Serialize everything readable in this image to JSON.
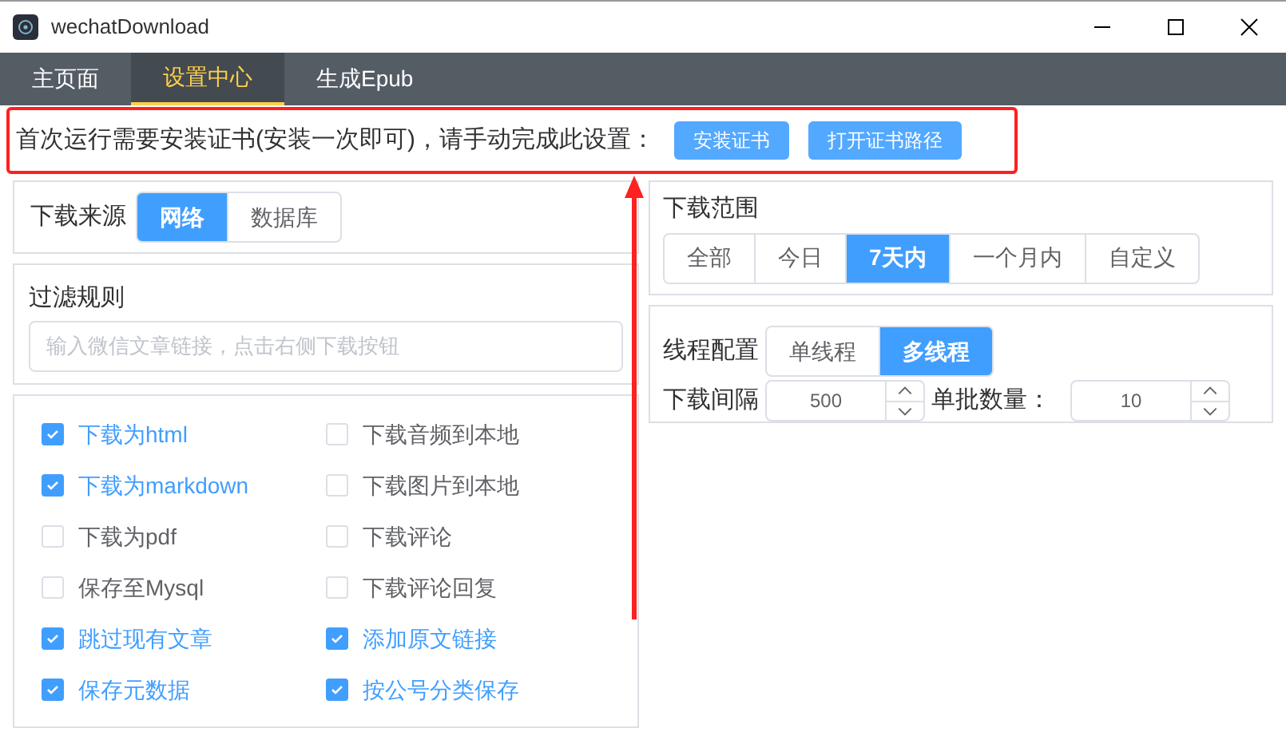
{
  "window": {
    "title": "wechatDownload"
  },
  "tabs": [
    {
      "label": "主页面",
      "selected": false
    },
    {
      "label": "设置中心",
      "selected": true
    },
    {
      "label": "生成Epub",
      "selected": false
    }
  ],
  "notice": {
    "text": "首次运行需要安装证书(安装一次即可)，请手动完成此设置：",
    "buttons": [
      "安装证书",
      "打开证书路径"
    ]
  },
  "source": {
    "label": "下载来源",
    "options": [
      {
        "label": "网络",
        "selected": true
      },
      {
        "label": "数据库",
        "selected": false
      }
    ]
  },
  "filter": {
    "label": "过滤规则",
    "placeholder": "输入微信文章链接，点击右侧下载按钮"
  },
  "options": [
    {
      "label": "下载为html",
      "checked": true
    },
    {
      "label": "下载音频到本地",
      "checked": false
    },
    {
      "label": "下载为markdown",
      "checked": true
    },
    {
      "label": "下载图片到本地",
      "checked": false
    },
    {
      "label": "下载为pdf",
      "checked": false
    },
    {
      "label": "下载评论",
      "checked": false
    },
    {
      "label": "保存至Mysql",
      "checked": false
    },
    {
      "label": "下载评论回复",
      "checked": false
    },
    {
      "label": "跳过现有文章",
      "checked": true
    },
    {
      "label": "添加原文链接",
      "checked": true
    },
    {
      "label": "保存元数据",
      "checked": true
    },
    {
      "label": "按公号分类保存",
      "checked": true
    }
  ],
  "range": {
    "label": "下载范围",
    "options": [
      {
        "label": "全部",
        "selected": false
      },
      {
        "label": "今日",
        "selected": false
      },
      {
        "label": "7天内",
        "selected": true
      },
      {
        "label": "一个月内",
        "selected": false
      },
      {
        "label": "自定义",
        "selected": false
      }
    ]
  },
  "threads": {
    "label": "线程配置",
    "options": [
      {
        "label": "单线程",
        "selected": false
      },
      {
        "label": "多线程",
        "selected": true
      }
    ],
    "interval_label": "下载间隔",
    "interval": "500",
    "batch_label": "单批数量：",
    "batch": "10"
  }
}
